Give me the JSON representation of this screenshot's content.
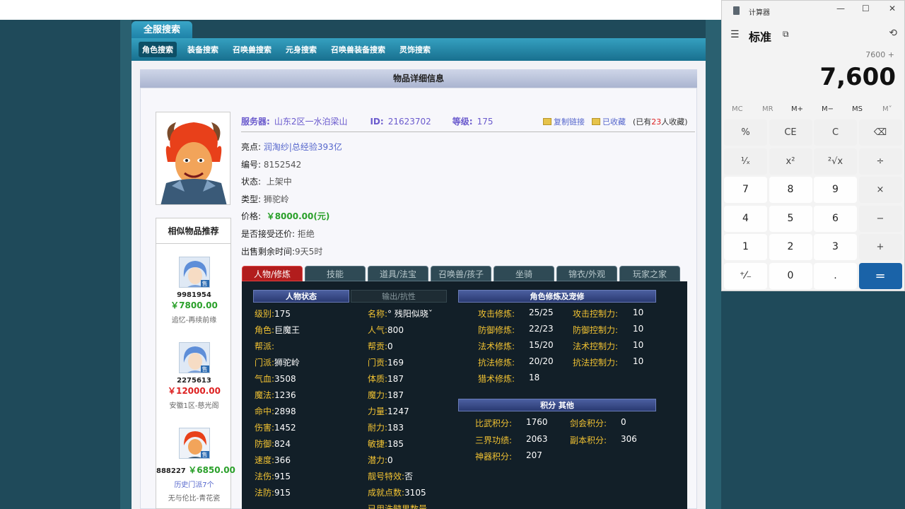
{
  "nav": {
    "main_tab": "全服搜索",
    "sub_tabs": [
      "角色搜索",
      "装备搜索",
      "召唤兽搜索",
      "元身搜索",
      "召唤兽装备搜索",
      "灵饰搜索"
    ]
  },
  "detail": {
    "title": "物品详细信息",
    "server_label": "服务器:",
    "server": "山东2区一水泊梁山",
    "id_label": "ID:",
    "id": "21623702",
    "level_label": "等级:",
    "level": "175",
    "copy_link": "复制链接",
    "favorited": "已收藏",
    "fav_note_pre": "(已有",
    "fav_count": "23",
    "fav_note_post": "人收藏)",
    "highlight_label": "亮点:",
    "highlight": "润淘纱|总经验393亿",
    "code_label": "编号:",
    "code": "8152542",
    "status_label": "状态:",
    "status": "上架中",
    "type_label": "类型:",
    "type": "狮驼岭",
    "price_label": "价格:",
    "price": "￥8000.00(元)",
    "counter_label": "是否接受还价:",
    "counter": "拒绝",
    "remain_label": "出售剩余时间:",
    "remain": "9天5时"
  },
  "similar": {
    "title": "相似物品推荐",
    "items": [
      {
        "id": "9981954",
        "price": "￥7800.00",
        "server": "追忆-再续前缘"
      },
      {
        "id": "2275613",
        "price": "￥12000.00",
        "server": "安徽1区-慈光阁"
      },
      {
        "id": "888227",
        "price": "￥6850.00",
        "extra": "历史门派7个",
        "server": "无与伦比-青花瓷"
      }
    ]
  },
  "tabs": [
    "人物/修炼",
    "技能",
    "道具/法宝",
    "召唤兽/孩子",
    "坐骑",
    "锦衣/外观",
    "玩家之家"
  ],
  "sections": {
    "char_state": "人物状态",
    "output": "输出/抗性",
    "cultivation": "角色修炼及宠修",
    "points": "积分 其他"
  },
  "char_left": [
    {
      "k": "级别:",
      "v": "175"
    },
    {
      "k": "角色:",
      "v": "巨魔王"
    },
    {
      "k": "帮派:",
      "v": ""
    },
    {
      "k": "门派:",
      "v": "狮驼岭"
    },
    {
      "k": "气血:",
      "v": "3508"
    },
    {
      "k": "魔法:",
      "v": "1236"
    },
    {
      "k": "命中:",
      "v": "2898"
    },
    {
      "k": "伤害:",
      "v": "1452"
    },
    {
      "k": "防御:",
      "v": "824"
    },
    {
      "k": "速度:",
      "v": "366"
    },
    {
      "k": "法伤:",
      "v": "915"
    },
    {
      "k": "法防:",
      "v": "915"
    }
  ],
  "char_right": [
    {
      "k": "名称:",
      "v": "° 残阳似晓ˇ"
    },
    {
      "k": "人气:",
      "v": "800"
    },
    {
      "k": "帮贡:",
      "v": "0"
    },
    {
      "k": "门贡:",
      "v": "169"
    },
    {
      "k": "体质:",
      "v": "187"
    },
    {
      "k": "魔力:",
      "v": "187"
    },
    {
      "k": "力量:",
      "v": "1247"
    },
    {
      "k": "耐力:",
      "v": "183"
    },
    {
      "k": "敏捷:",
      "v": "185"
    },
    {
      "k": "潜力:",
      "v": "0"
    },
    {
      "k": "靓号特效:",
      "v": "否"
    },
    {
      "k": "成就点数:",
      "v": "3105"
    },
    {
      "k": "已用洗髓果数量",
      "v": ""
    }
  ],
  "cult_left": [
    {
      "k": "攻击修炼:",
      "v": "25/25"
    },
    {
      "k": "防御修炼:",
      "v": "22/23"
    },
    {
      "k": "法术修炼:",
      "v": "15/20"
    },
    {
      "k": "抗法修炼:",
      "v": "20/20"
    },
    {
      "k": "猎术修炼:",
      "v": "18"
    }
  ],
  "cult_right": [
    {
      "k": "攻击控制力:",
      "v": "10"
    },
    {
      "k": "防御控制力:",
      "v": "10"
    },
    {
      "k": "法术控制力:",
      "v": "10"
    },
    {
      "k": "抗法控制力:",
      "v": "10"
    }
  ],
  "points_left": [
    {
      "k": "比武积分:",
      "v": "1760"
    },
    {
      "k": "三界功绩:",
      "v": "2063"
    },
    {
      "k": "神器积分:",
      "v": "207"
    }
  ],
  "points_right": [
    {
      "k": "剑会积分:",
      "v": "0"
    },
    {
      "k": "副本积分:",
      "v": "306"
    }
  ],
  "calculator": {
    "app_title": "计算器",
    "mode": "标准",
    "expression": "7600 +",
    "display": "7,600",
    "memory": [
      "MC",
      "MR",
      "M+",
      "M−",
      "MS",
      "M˅"
    ],
    "keys": [
      [
        "%",
        "CE",
        "C",
        "⌫"
      ],
      [
        "¹⁄ₓ",
        "x²",
        "²√x",
        "÷"
      ],
      [
        "7",
        "8",
        "9",
        "×"
      ],
      [
        "4",
        "5",
        "6",
        "−"
      ],
      [
        "1",
        "2",
        "3",
        "+"
      ],
      [
        "⁺⁄₋",
        "0",
        ".",
        "="
      ]
    ]
  },
  "colors": {
    "accent_blue": "#1a63a8",
    "tab_active": "#b21d1d",
    "label_gold": "#f1c232",
    "price_green": "#2aa02a",
    "price_red": "#d22222"
  }
}
